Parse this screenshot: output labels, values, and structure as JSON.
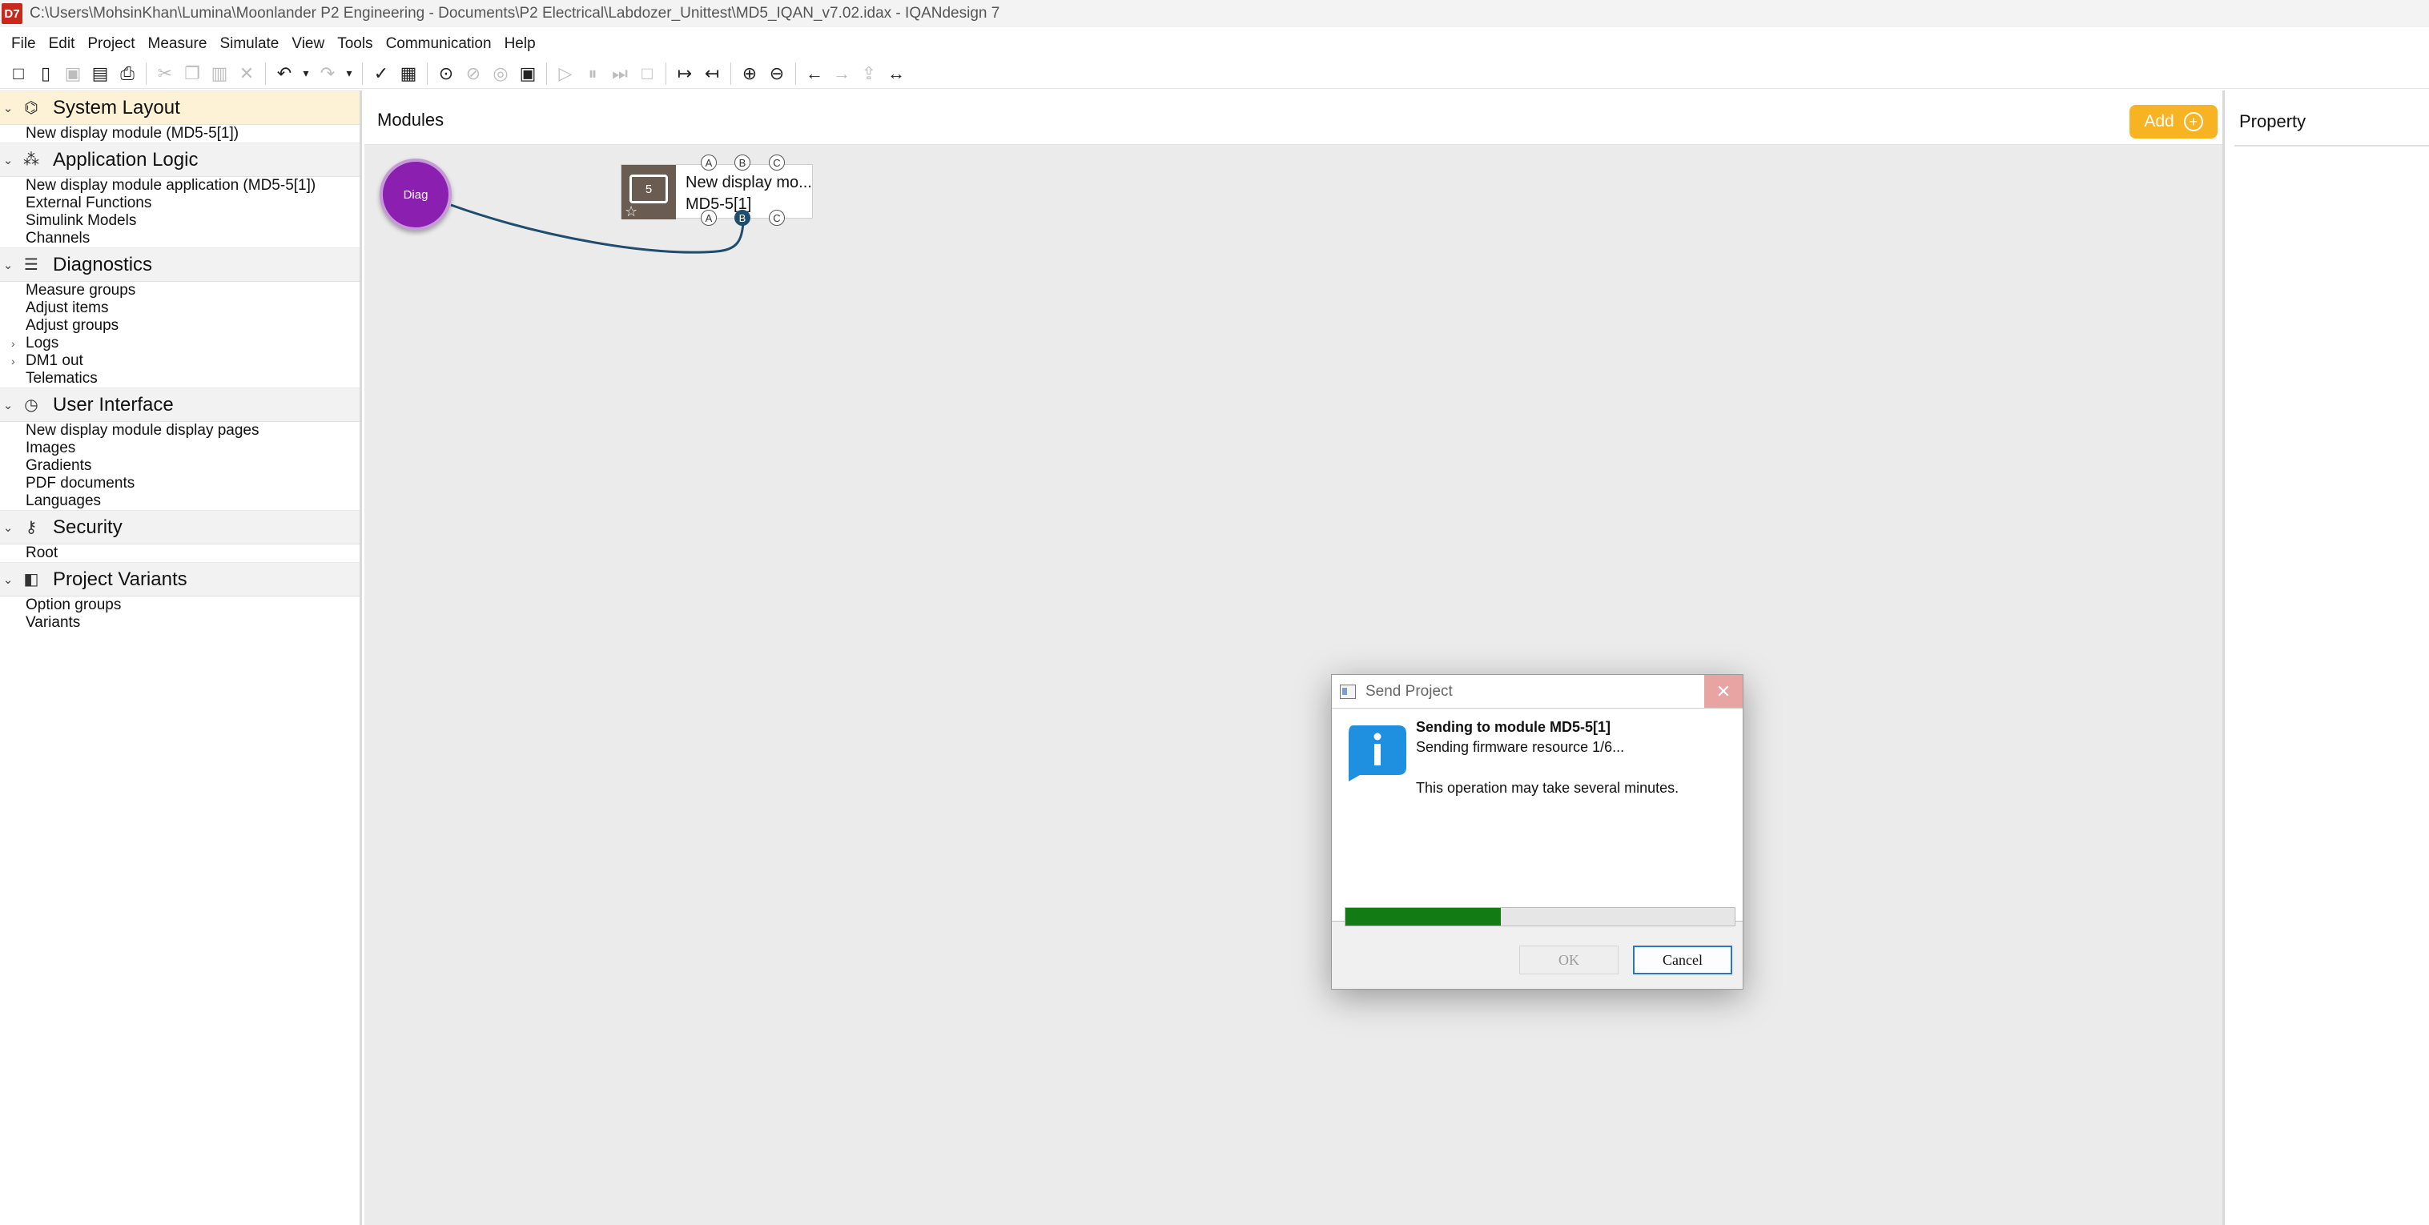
{
  "window": {
    "app_icon_label": "D7",
    "title": "C:\\Users\\MohsinKhan\\Lumina\\Moonlander P2 Engineering - Documents\\P2 Electrical\\Labdozer_Unittest\\MD5_IQAN_v7.02.idax - IQANdesign 7"
  },
  "menu": [
    "File",
    "Edit",
    "Project",
    "Measure",
    "Simulate",
    "View",
    "Tools",
    "Communication",
    "Help"
  ],
  "toolbar_icons": {
    "new": "□",
    "open": "▯",
    "save": "▣",
    "save_as": "▤",
    "print": "⎙",
    "cut": "✂",
    "copy": "❐",
    "paste": "▥",
    "delete": "✕",
    "undo": "↶",
    "undo_menu": "▾",
    "redo": "↷",
    "redo_menu": "▾",
    "validate": "✓",
    "presentation": "▦",
    "record": "⊙",
    "pause_rec": "⊘",
    "stop_rec": "◎",
    "snapshot": "▣",
    "play": "▷",
    "pause": "⏸",
    "step": "⏭",
    "stop": "□",
    "expand": "↦",
    "collapse": "↤",
    "zoom_in": "⊕",
    "zoom_out": "⊖",
    "back": "←",
    "forward": "→",
    "export": "⇪",
    "fit": "↔"
  },
  "sidebar": {
    "sections": [
      {
        "title": "System Layout",
        "icon": "⌬",
        "items": [
          {
            "label": "New display module (MD5-5[1])"
          }
        ]
      },
      {
        "title": "Application Logic",
        "icon": "⁂",
        "items": [
          {
            "label": "New display module application (MD5-5[1])"
          },
          {
            "label": "External Functions"
          },
          {
            "label": "Simulink Models"
          },
          {
            "label": "Channels"
          }
        ]
      },
      {
        "title": "Diagnostics",
        "icon": "☰",
        "items": [
          {
            "label": "Measure groups"
          },
          {
            "label": "Adjust items"
          },
          {
            "label": "Adjust groups"
          },
          {
            "label": "Logs",
            "expandable": true
          },
          {
            "label": "DM1 out",
            "expandable": true
          },
          {
            "label": "Telematics"
          }
        ]
      },
      {
        "title": "User Interface",
        "icon": "◷",
        "items": [
          {
            "label": "New display module display pages"
          },
          {
            "label": "Images"
          },
          {
            "label": "Gradients"
          },
          {
            "label": "PDF documents"
          },
          {
            "label": "Languages"
          }
        ]
      },
      {
        "title": "Security",
        "icon": "⚷",
        "items": [
          {
            "label": "Root"
          }
        ]
      },
      {
        "title": "Project Variants",
        "icon": "◧",
        "items": [
          {
            "label": "Option groups"
          },
          {
            "label": "Variants"
          }
        ]
      }
    ]
  },
  "modules": {
    "title": "Modules",
    "add_label": "Add",
    "add_icon": "+",
    "diag_label": "Diag",
    "module": {
      "screen_number": "5",
      "name": "New display mo...",
      "id": "MD5-5[1]",
      "ports": [
        "A",
        "B",
        "C"
      ]
    }
  },
  "property": {
    "title": "Property"
  },
  "dialog": {
    "title": "Send Project",
    "close_icon": "✕",
    "heading": "Sending to module MD5-5[1]",
    "status": "Sending firmware resource 1/6...",
    "note": "This operation may take several minutes.",
    "progress": 0.4,
    "ok_label": "OK",
    "cancel_label": "Cancel",
    "accent": "#1f8fe0",
    "progress_color": "#137b13"
  }
}
